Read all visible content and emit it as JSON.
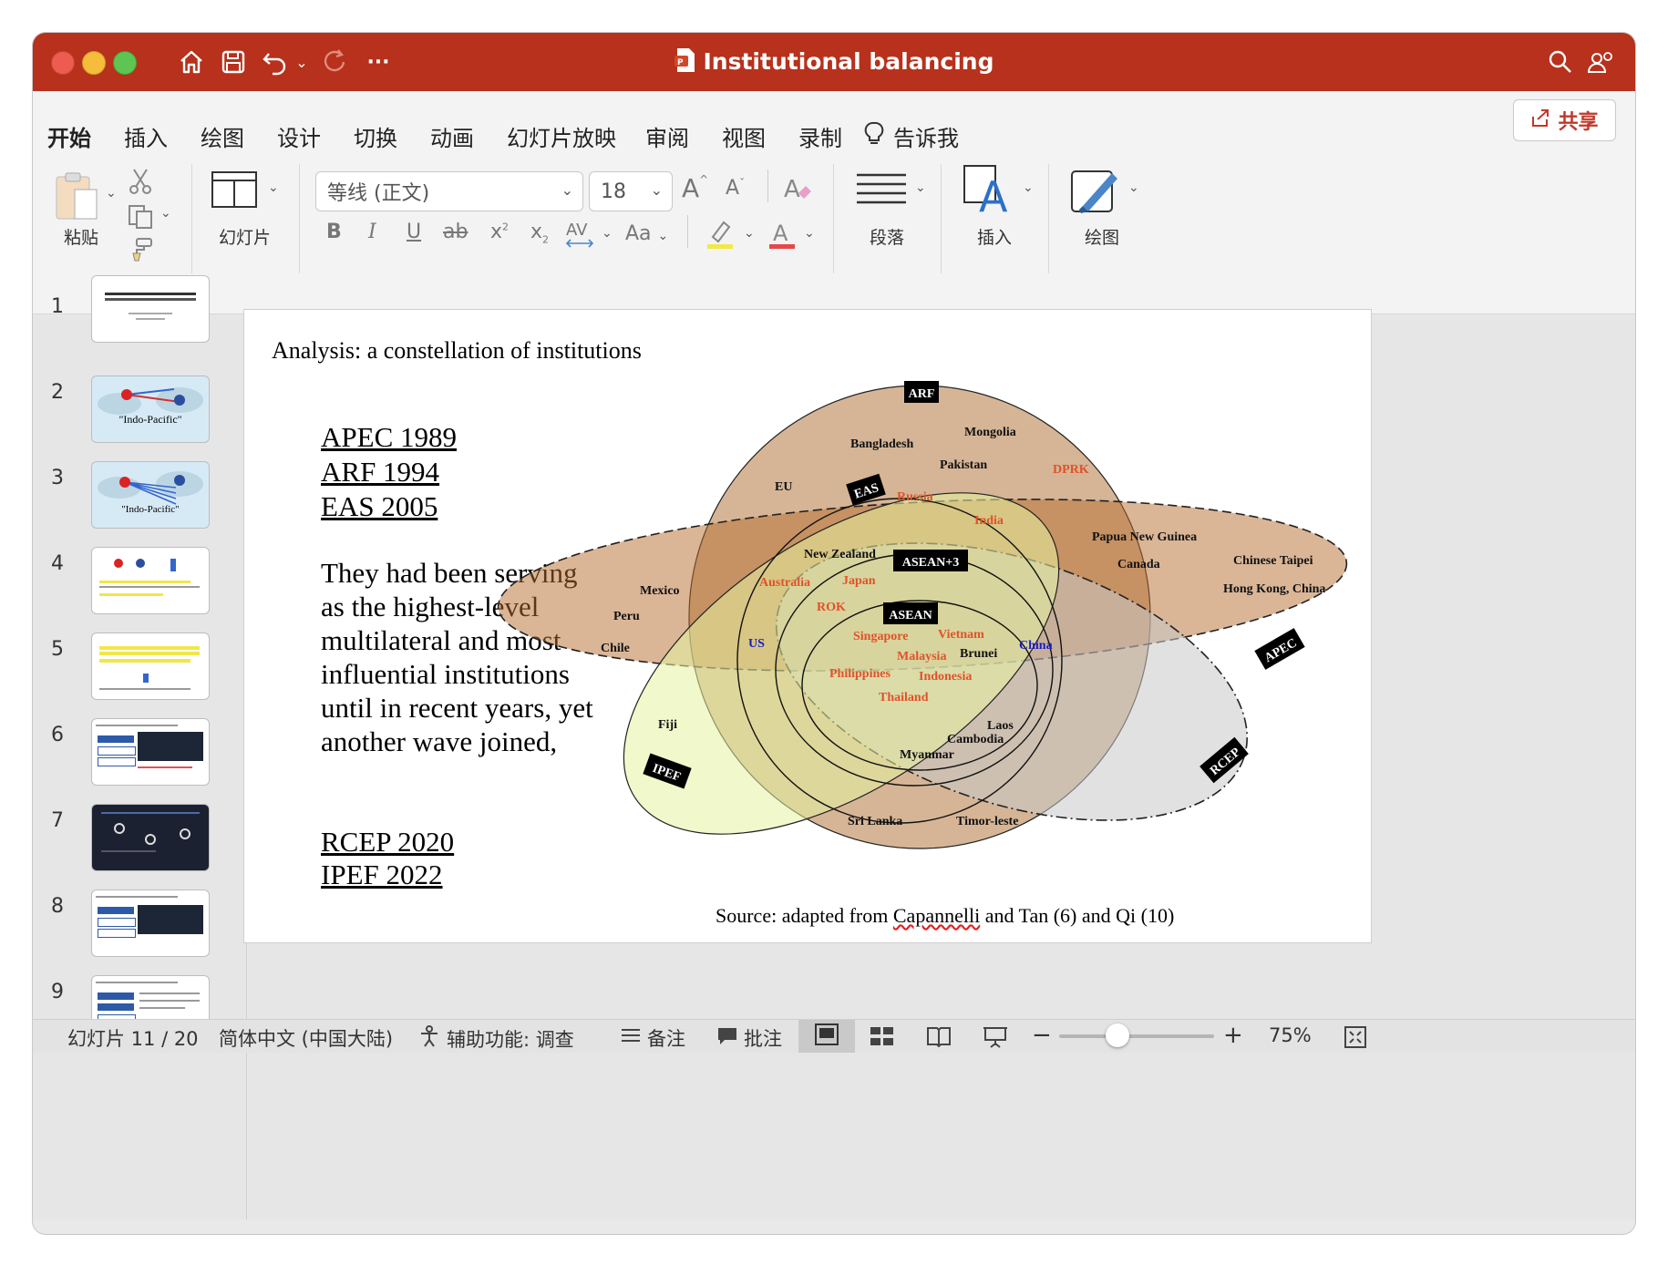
{
  "window": {
    "title": "Institutional balancing"
  },
  "ribbon": {
    "tabs": [
      "开始",
      "插入",
      "绘图",
      "设计",
      "切换",
      "动画",
      "幻灯片放映",
      "审阅",
      "视图",
      "录制"
    ],
    "tell_me": "告诉我",
    "share": "共享"
  },
  "toolbar": {
    "paste": "粘贴",
    "slides": "幻灯片",
    "font_name": "等线 (正文)",
    "font_size": "18",
    "paragraph": "段落",
    "insert": "插入",
    "draw": "绘图",
    "case_label": "Aa"
  },
  "slides": {
    "numbers": [
      "1",
      "2",
      "3",
      "4",
      "5",
      "6",
      "7",
      "8",
      "9"
    ],
    "thumb2_caption": "\"Indo-Pacific\"",
    "thumb3_caption": "\"Indo-Pacific\""
  },
  "slide": {
    "title": "Analysis: a constellation of institutions",
    "list_top": [
      "APEC 1989",
      "ARF 1994",
      "EAS 2005"
    ],
    "body": "They had been serving as the highest-level multilateral and most influential institutions until in recent years, yet another wave joined,",
    "list_bottom": [
      "RCEP 2020",
      "IPEF 2022"
    ],
    "source_prefix": "Source: adapted from ",
    "source_name": "Capannelli",
    "source_suffix": " and Tan (6) and Qi (10)"
  },
  "diagram": {
    "groups": [
      "ARF",
      "EAS",
      "ASEAN+3",
      "ASEAN",
      "APEC",
      "RCEP",
      "IPEF"
    ],
    "members": {
      "bangladesh": "Bangladesh",
      "mongolia": "Mongolia",
      "pakistan": "Pakistan",
      "dprk": "DPRK",
      "eu": "EU",
      "russia": "Russia",
      "india": "India",
      "png": "Papua  New  Guinea",
      "canada": "Canada",
      "chinese_taipei": "Chinese  Taipei",
      "hong_kong": "Hong  Kong,  China",
      "new_zealand": "New  Zealand",
      "australia": "Australia",
      "japan": "Japan",
      "rok": "ROK",
      "mexico": "Mexico",
      "peru": "Peru",
      "chile": "Chile",
      "us": "US",
      "singapore": "Singapore",
      "vietnam": "Vietnam",
      "malaysia": "Malaysia",
      "brunei": "Brunei",
      "china": "China",
      "philippines": "Philippines",
      "indonesia": "Indonesia",
      "thailand": "Thailand",
      "fiji": "Fiji",
      "laos": "Laos",
      "cambodia": "Cambodia",
      "myanmar": "Myanmar",
      "sri_lanka": "Sri  Lanka",
      "timor_leste": "Timor-leste"
    },
    "colors": {
      "orange_text": "#e0522a",
      "blue_text": "#1a1acc",
      "black_text": "#111111"
    }
  },
  "status": {
    "slide_counter": "幻灯片 11 / 20",
    "language": "简体中文 (中国大陆)",
    "accessibility": "辅助功能: 调查",
    "notes": "备注",
    "comments": "批注",
    "zoom": "75%"
  },
  "colors": {
    "titlebar": "#b7311c",
    "accent": "#c0392b"
  }
}
